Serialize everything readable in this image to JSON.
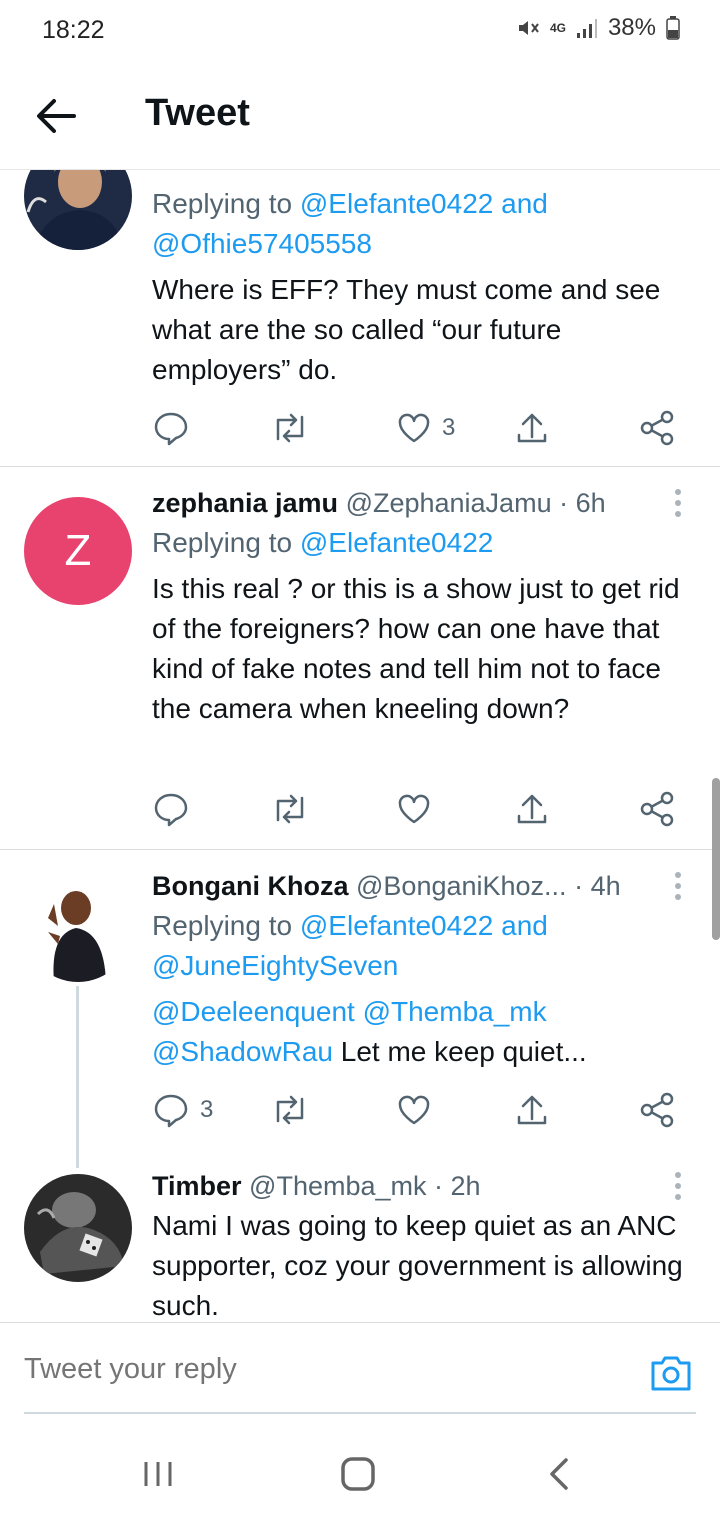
{
  "status_bar": {
    "time": "18:22",
    "network": "4G",
    "battery": "38%"
  },
  "header": {
    "title": "Tweet",
    "back_icon": "arrow-left-icon"
  },
  "colors": {
    "accent": "#1d9bf0",
    "avatar_z": "#e8436e",
    "text": "#0f1419",
    "muted": "#536471"
  },
  "tweets": [
    {
      "replying_prefix": "Replying to ",
      "mentions": [
        "@Elefante0422",
        "@Ofhie57405558"
      ],
      "and": "and",
      "text": "Where is EFF? They must come and see what are the so called “our future employers” do.",
      "likes": "3"
    },
    {
      "avatar_letter": "Z",
      "name": "zephania jamu",
      "handle": "@ZephaniaJamu",
      "time": "· 6h",
      "replying_prefix": "Replying to ",
      "mentions": [
        "@Elefante0422"
      ],
      "text": "Is this real ? or this is a show just to get rid of the foreigners? how can one have that kind of fake notes and tell him not to face the camera when kneeling down?"
    },
    {
      "name": "Bongani Khoza",
      "handle": "@BonganiKhoz...",
      "time": "· 4h",
      "replying_prefix": "Replying to ",
      "mentions": [
        "@Elefante0422",
        "@JuneEightySeven"
      ],
      "and": "and",
      "text_mentions": [
        "@Deeleenquent",
        "@Themba_mk",
        "@ShadowRau"
      ],
      "text": "Let me keep quiet...",
      "replies": "3"
    },
    {
      "name": "Timber",
      "handle": "@Themba_mk",
      "time": "· 2h",
      "text": "Nami I was going to keep quiet as an ANC supporter, coz your government is allowing such."
    }
  ],
  "reply_bar": {
    "placeholder": "Tweet your reply"
  }
}
